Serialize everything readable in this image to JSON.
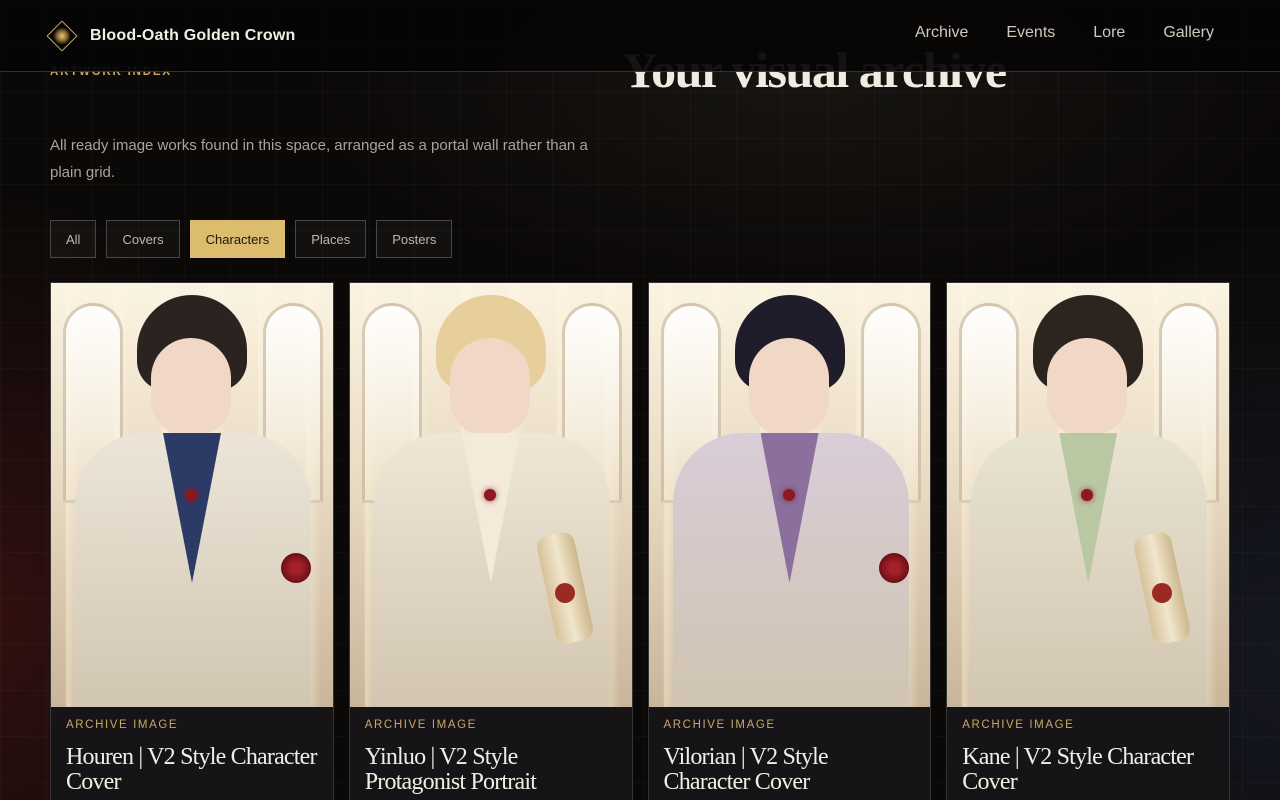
{
  "brand": {
    "name": "Blood-Oath Golden Crown"
  },
  "nav": {
    "items": [
      "Archive",
      "Events",
      "Lore",
      "Gallery"
    ]
  },
  "hero": {
    "eyebrow": "ARTWORK INDEX",
    "title": "Your visual archive",
    "description": "All ready image works found in this space, arranged as a portal wall rather than a plain grid."
  },
  "filters": {
    "items": [
      "All",
      "Covers",
      "Characters",
      "Places",
      "Posters"
    ],
    "active": "Characters"
  },
  "cards": [
    {
      "tag": "ARCHIVE IMAGE",
      "title": "Houren | V2 Style Character Cover",
      "hair": "#2a2320",
      "outfit": "#ece5d8",
      "lapel": "#2c3a66",
      "accent": "rose"
    },
    {
      "tag": "ARCHIVE IMAGE",
      "title": "Yinluo | V2 Style Protagonist Portrait",
      "hair": "#e7cf9c",
      "outfit": "#efe6d6",
      "lapel": "#f3ead9",
      "accent": "scroll"
    },
    {
      "tag": "ARCHIVE IMAGE",
      "title": "Vilorian | V2 Style Character Cover",
      "hair": "#1f1c2b",
      "outfit": "#d9cdd8",
      "lapel": "#8b6f9c",
      "accent": "rose"
    },
    {
      "tag": "ARCHIVE IMAGE",
      "title": "Kane | V2 Style Character Cover",
      "hair": "#2c241e",
      "outfit": "#e9e3d2",
      "lapel": "#b9c7a3",
      "accent": "scroll"
    }
  ],
  "colors": {
    "gold": "#dcbd6e",
    "accent_text": "#c9a866",
    "background": "#0b0908"
  }
}
